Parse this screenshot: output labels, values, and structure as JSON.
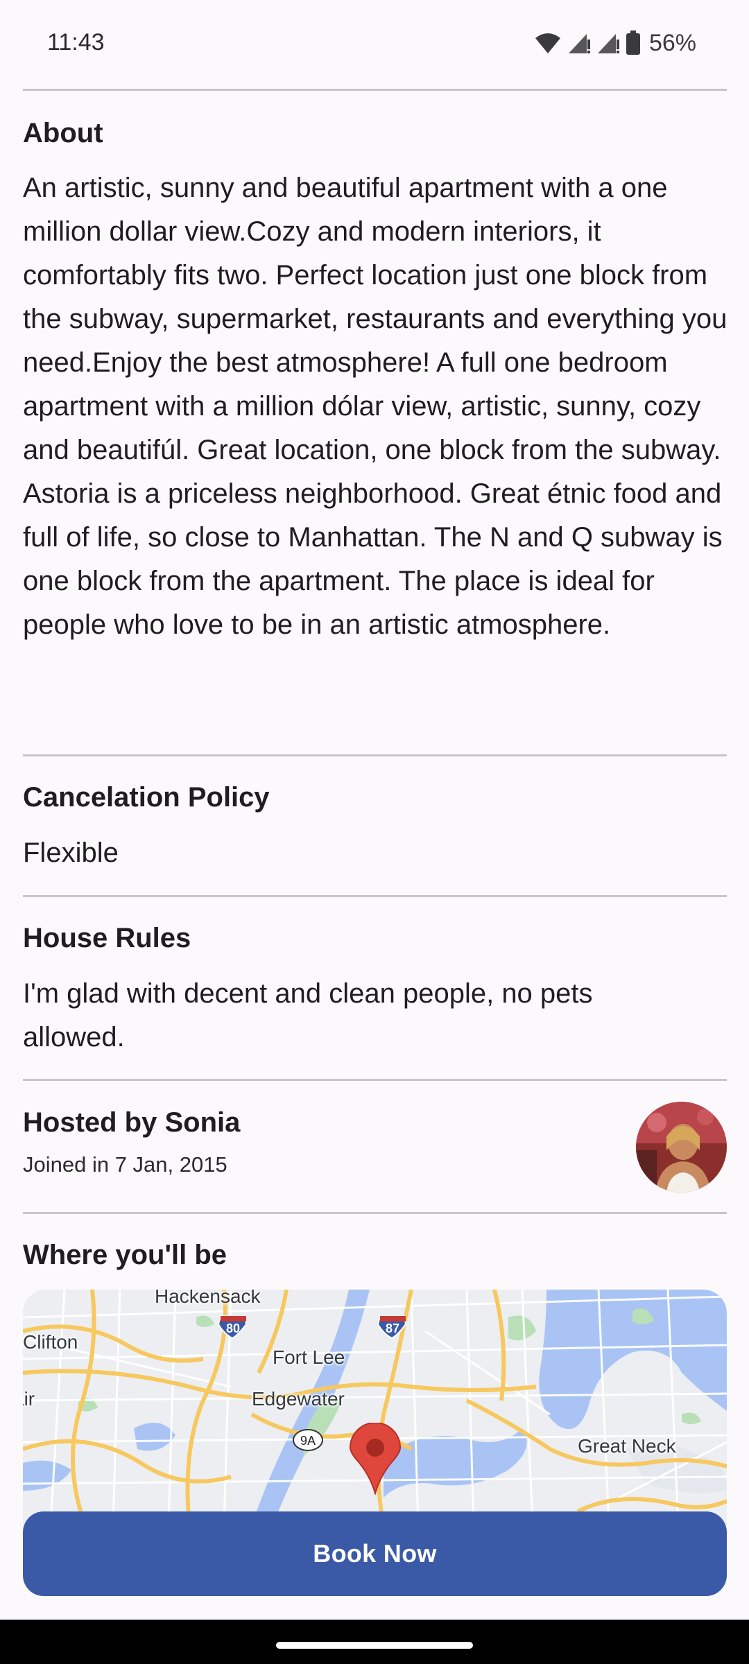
{
  "status_bar": {
    "time": "11:43",
    "battery": "56%",
    "icons": [
      "wifi-icon",
      "signal-icon",
      "signal-icon",
      "battery-icon"
    ]
  },
  "about": {
    "title": "About",
    "text": "An artistic, sunny and beautiful apartment with a one million dollar view.Cozy and modern interiors, it comfortably fits two. Perfect location just one block from the subway, supermarket, restaurants and everything you need.Enjoy the best atmosphere! A full one bedroom apartment with a million dólar view,  artistic, sunny, cozy and beautifúl.  Great location, one block from the subway. Astoria is a priceless neighborhood. Great étnic  food and full of life, so close to Manhattan. The N and Q subway is one block from the apartment. The place is ideal for people who love to be in an  artistic atmosphere."
  },
  "cancelation": {
    "title": "Cancelation Policy",
    "value": "Flexible"
  },
  "house_rules": {
    "title": "House Rules",
    "text": "I'm glad with decent and clean people, no pets allowed."
  },
  "host": {
    "title": "Hosted by Sonia",
    "joined": "Joined in 7 Jan, 2015"
  },
  "location": {
    "title": "Where you'll be",
    "map_labels": [
      "Hackensack",
      "Clifton",
      "Fort Lee",
      "Edgewater",
      "Great Neck",
      "air"
    ],
    "route_shields": [
      "80",
      "87",
      "9A"
    ]
  },
  "actions": {
    "book_label": "Book Now"
  },
  "colors": {
    "accent": "#3a5aa7",
    "background": "#fcf9fc",
    "map_water": "#a9c4f4",
    "map_road": "#f6c85f",
    "pin": "#e0473c"
  }
}
